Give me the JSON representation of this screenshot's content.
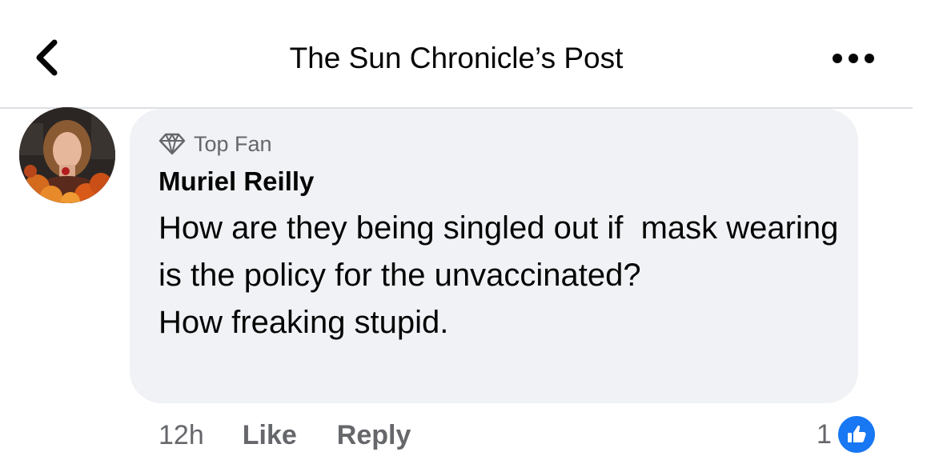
{
  "header": {
    "title": "The Sun Chronicle’s Post",
    "back_icon": "chevron-left-icon",
    "more_icon": "more-horizontal-icon"
  },
  "comment": {
    "badge": "Top Fan",
    "badge_icon": "diamond-icon",
    "author": "Muriel Reilly",
    "lines": [
      "How are they being singled out if  mask wearing is the policy for the unvaccinated?",
      "How freaking stupid."
    ],
    "time": "12h",
    "like_label": "Like",
    "reply_label": "Reply",
    "reaction_count": "1",
    "reaction_icon": "thumbs-up-icon"
  },
  "colors": {
    "accent": "#1877f2",
    "bubble": "#f0f2f5",
    "secondary_text": "#65676b"
  }
}
